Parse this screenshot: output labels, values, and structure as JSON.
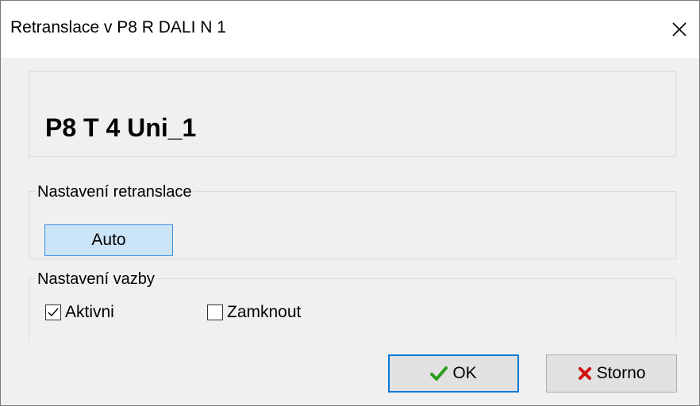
{
  "window": {
    "title": "Retranslace v P8 R DALI N 1"
  },
  "header": {
    "title": "P8 T 4 Uni_1"
  },
  "retranslation_group": {
    "label": "Nastavení retranslace",
    "mode_button_label": "Auto"
  },
  "binding_group": {
    "label": "Nastavení vazby",
    "active": {
      "label": "Aktivni",
      "checked": true
    },
    "lock": {
      "label": "Zamknout",
      "checked": false
    }
  },
  "buttons": {
    "ok_label": "OK",
    "cancel_label": "Storno"
  },
  "colors": {
    "ok_icon": "#2a9d1f",
    "cancel_icon": "#d01010",
    "accent": "#0078d7",
    "selected_bg": "#cce4f7"
  },
  "icons": {
    "close": "close-icon",
    "ok": "checkmark-icon",
    "cancel": "x-icon"
  }
}
